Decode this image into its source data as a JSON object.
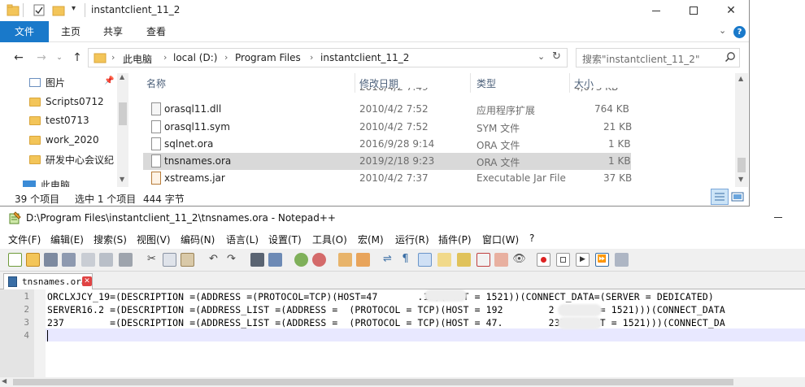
{
  "explorer": {
    "title": "instantclient_11_2",
    "ribbon_tabs": [
      "文件",
      "主页",
      "共享",
      "查看"
    ],
    "breadcrumb": [
      "此电脑",
      "local (D:)",
      "Program Files",
      "instantclient_11_2"
    ],
    "search_placeholder": "搜索\"instantclient_11_2\"",
    "nav_items": [
      "图片",
      "Scripts0712",
      "test0713",
      "work_2020",
      "研发中心会议纪",
      "此电脑"
    ],
    "columns": [
      "名称",
      "修改日期",
      "类型",
      "大小"
    ],
    "files": [
      {
        "name": "orasql11.dll",
        "date": "2010/4/2 7:52",
        "type": "应用程序扩展",
        "size": "764 KB"
      },
      {
        "name": "orasql11.sym",
        "date": "2010/4/2 7:52",
        "type": "SYM 文件",
        "size": "21 KB"
      },
      {
        "name": "sqlnet.ora",
        "date": "2016/9/28 9:14",
        "type": "ORA 文件",
        "size": "1 KB"
      },
      {
        "name": "tnsnames.ora",
        "date": "2019/2/18 9:23",
        "type": "ORA 文件",
        "size": "1 KB"
      },
      {
        "name": "xstreams.jar",
        "date": "2010/4/2 7:37",
        "type": "Executable Jar File",
        "size": "37 KB"
      }
    ],
    "status": {
      "count": "39 个项目",
      "selected": "选中 1 个项目",
      "size": "444 字节"
    }
  },
  "npp": {
    "title": "D:\\Program Files\\instantclient_11_2\\tnsnames.ora - Notepad++",
    "menu": [
      "文件(F)",
      "编辑(E)",
      "搜索(S)",
      "视图(V)",
      "编码(N)",
      "语言(L)",
      "设置(T)",
      "工具(O)",
      "宏(M)",
      "运行(R)",
      "插件(P)",
      "窗口(W)",
      "?"
    ],
    "tab_label": "tnsnames.ora",
    "lines": [
      {
        "no": "1",
        "text": "ORCLXJCY_19=(DESCRIPTION =(ADDRESS =(PROTOCOL=TCP)(HOST=47       .19)(PORT = 1521))(CONNECT_DATA=(SERVER = DEDICATED)"
      },
      {
        "no": "2",
        "text": "SERVER16.2 =(DESCRIPTION =(ADDRESS_LIST =(ADDRESS =  (PROTOCOL = TCP)(HOST = 192        2 )(PORT = 1521)))(CONNECT_DATA"
      },
      {
        "no": "3",
        "text": "237        =(DESCRIPTION =(ADDRESS_LIST =(ADDRESS =  (PROTOCOL = TCP)(HOST = 47.        237 )(PORT = 1521)))(CONNECT_DA"
      },
      {
        "no": "4",
        "text": ""
      }
    ]
  },
  "colors": {
    "accent": "#1979ca",
    "selection": "#d9d9d9",
    "current_line": "#e8e8ff"
  }
}
